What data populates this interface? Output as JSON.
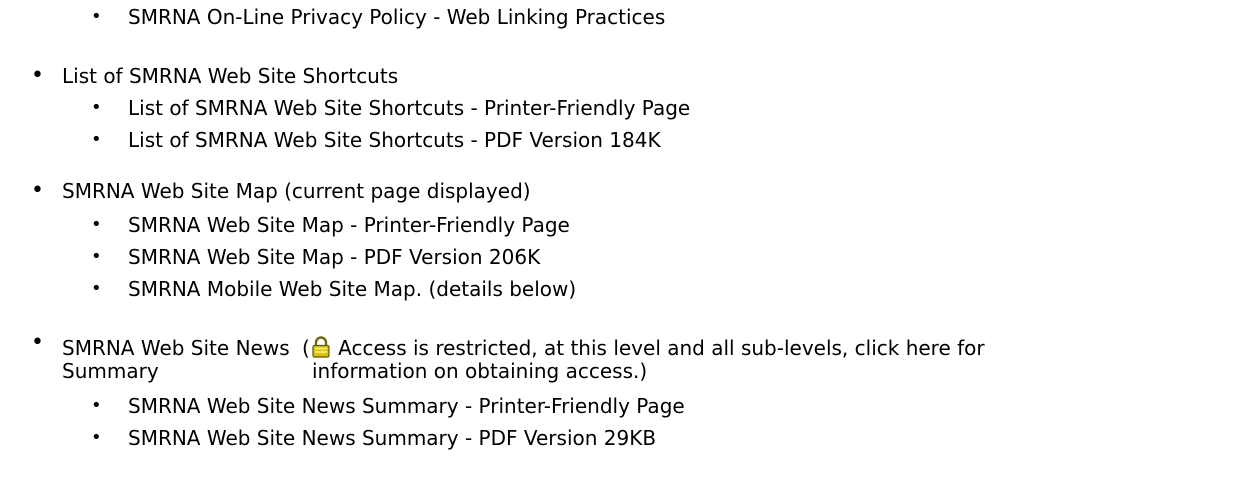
{
  "sections": [
    {
      "children": [
        {
          "label": "SMRNA On-Line Privacy Policy - Web Linking Practices"
        }
      ]
    },
    {
      "label": "List of SMRNA Web Site Shortcuts",
      "children": [
        {
          "label": "List of SMRNA Web Site Shortcuts - Printer-Friendly Page"
        },
        {
          "label": "List of SMRNA Web Site Shortcuts - PDF Version 184K"
        }
      ]
    },
    {
      "label": "SMRNA Web Site Map (current page displayed)",
      "children": [
        {
          "label": "SMRNA Web Site Map - Printer-Friendly Page"
        },
        {
          "label": "SMRNA Web Site Map - PDF Version 206K"
        },
        {
          "label": "SMRNA Mobile Web Site Map. (details below)"
        }
      ]
    },
    {
      "label_line1": "SMRNA Web Site News",
      "label_line2": "Summary",
      "note_open": "(",
      "note_line1": " Access is restricted, at this level and all sub-levels, click here for",
      "note_line2": "information on obtaining access.)",
      "children": [
        {
          "label": "SMRNA Web Site News Summary - Printer-Friendly Page"
        },
        {
          "label": "SMRNA Web Site News Summary - PDF Version 29KB"
        }
      ]
    }
  ],
  "bullet_glyph": "•",
  "icons": {
    "lock": "lock-icon"
  }
}
